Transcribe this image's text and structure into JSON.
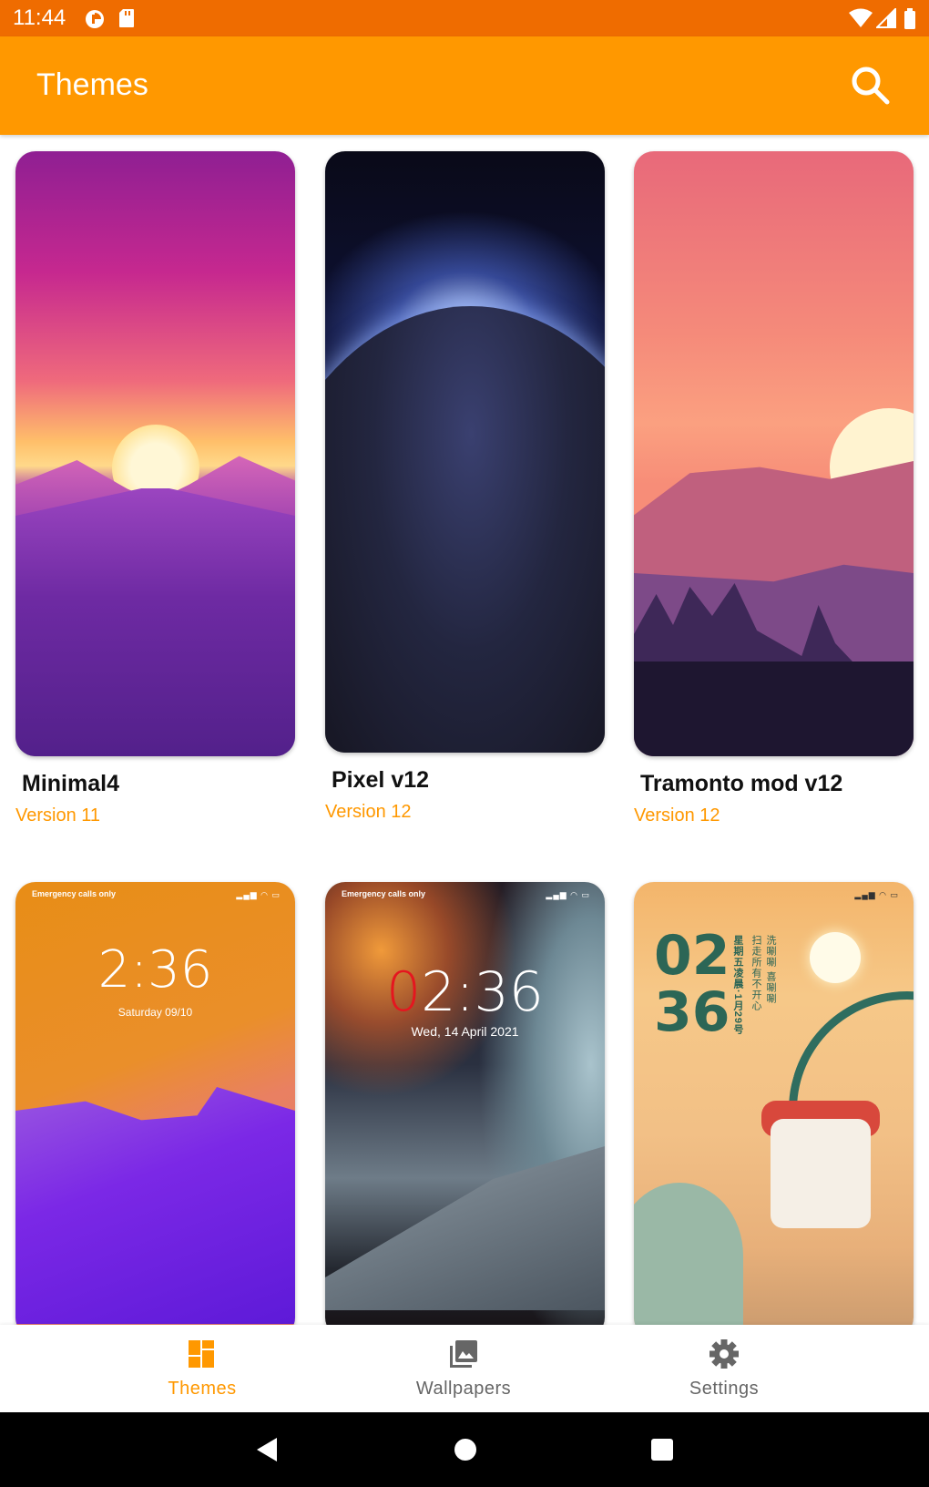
{
  "status_bar": {
    "time": "11:44",
    "left_icons": [
      "data-saver-icon",
      "sd-card-icon"
    ],
    "right_icons": [
      "wifi-icon",
      "cell-signal-icon",
      "battery-icon"
    ]
  },
  "app_bar": {
    "title": "Themes",
    "action_icon": "search-icon"
  },
  "colors": {
    "accent": "#FF9800",
    "status_bar": "#EF6C00",
    "inactive": "#666666"
  },
  "themes": [
    {
      "name": "Minimal4",
      "version": "Version 11"
    },
    {
      "name": "Pixel v12",
      "version": "Version 12"
    },
    {
      "name": "Tramonto mod v12",
      "version": "Version 12"
    },
    {
      "lock_status": "Emergency calls only",
      "lock_time": "2:36",
      "lock_date": "Saturday 09/10"
    },
    {
      "lock_status": "Emergency calls only",
      "lock_time_highlight": "0",
      "lock_time": "2:36",
      "lock_date": "Wed, 14 April 2021"
    },
    {
      "lock_hour": "02",
      "lock_minute": "36",
      "lock_text_a": "星期五凌晨·1月29号",
      "lock_text_b": "扫走所有不开心",
      "lock_text_c": "洗唰唰 喜唰唰"
    }
  ],
  "bottom_nav": {
    "items": [
      {
        "label": "Themes",
        "icon": "dashboard-icon",
        "active": true
      },
      {
        "label": "Wallpapers",
        "icon": "photo-library-icon",
        "active": false
      },
      {
        "label": "Settings",
        "icon": "gear-icon",
        "active": false
      }
    ]
  },
  "system_nav": [
    "back-icon",
    "home-icon",
    "recents-icon"
  ]
}
